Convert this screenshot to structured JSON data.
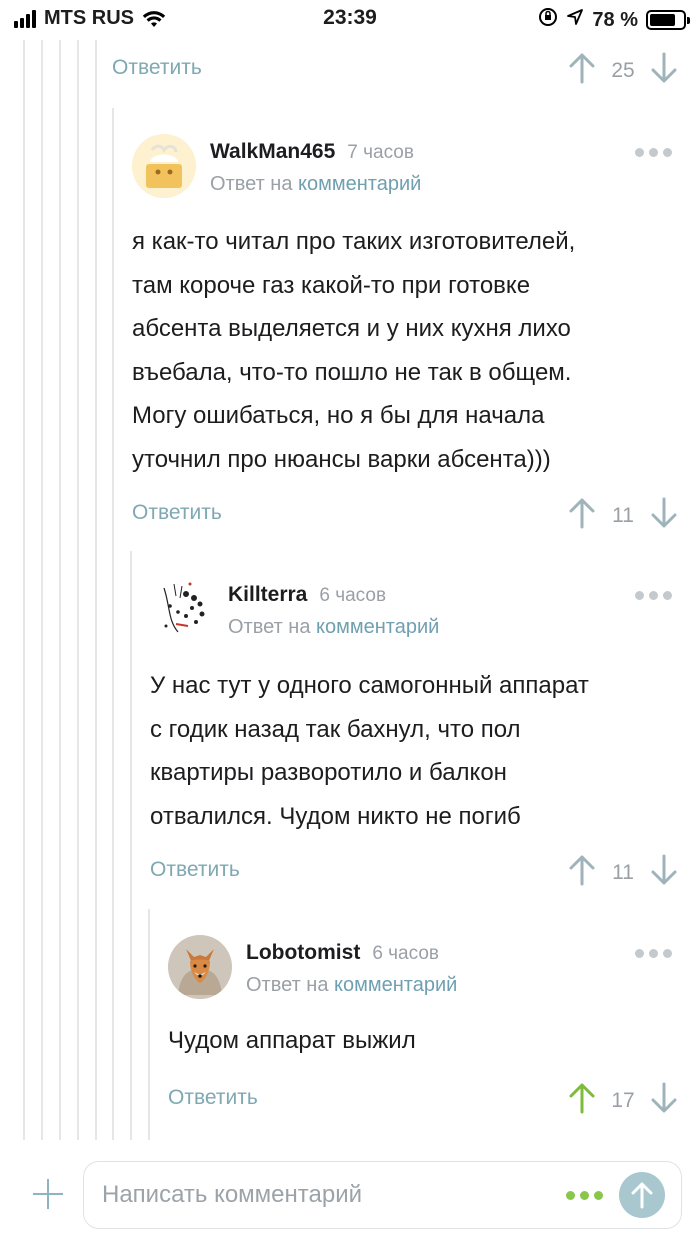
{
  "status_bar": {
    "carrier": "MTS RUS",
    "time": "23:39",
    "battery": "78 %",
    "battery_level": 0.78
  },
  "colors": {
    "accent": "#7fa8b3",
    "link": "#6f9fb0",
    "upvote_active": "#7dbb3d",
    "muted": "#9aa0a6"
  },
  "top_actions": {
    "reply_label": "Ответить",
    "votes": "25"
  },
  "comments": [
    {
      "username": "WalkMan465",
      "time": "7 часов",
      "reply_prefix": "Ответ на",
      "reply_link": "комментарий",
      "avatar": "cat-in-box-avatar",
      "lines": [
        "я как-то читал про таких изготовителей,",
        "там короче газ какой-то при готовке",
        "абсента выделяется и у них кухня лихо",
        "въебала, что-то пошло не так в общем.",
        "Могу ошибаться, но я бы для начала",
        "уточнил про нюансы варки абсента)))"
      ],
      "reply_label": "Ответить",
      "votes": "11"
    },
    {
      "username": "Killterra",
      "time": "6 часов",
      "reply_prefix": "Ответ на",
      "reply_link": "комментарий",
      "avatar": "sketch-face-avatar",
      "lines": [
        "У нас тут у одного самогонный аппарат",
        "с годик назад так бахнул, что пол",
        "квартиры разворотило и балкон",
        "отвалился. Чудом никто не погиб"
      ],
      "reply_label": "Ответить",
      "votes": "11"
    },
    {
      "username": "Lobotomist",
      "time": "6 часов",
      "reply_prefix": "Ответ на",
      "reply_link": "комментарий",
      "avatar": "fox-avatar",
      "lines": [
        "Чудом аппарат выжил"
      ],
      "reply_label": "Ответить",
      "votes": "17"
    }
  ],
  "composer": {
    "placeholder": "Написать комментарий"
  }
}
